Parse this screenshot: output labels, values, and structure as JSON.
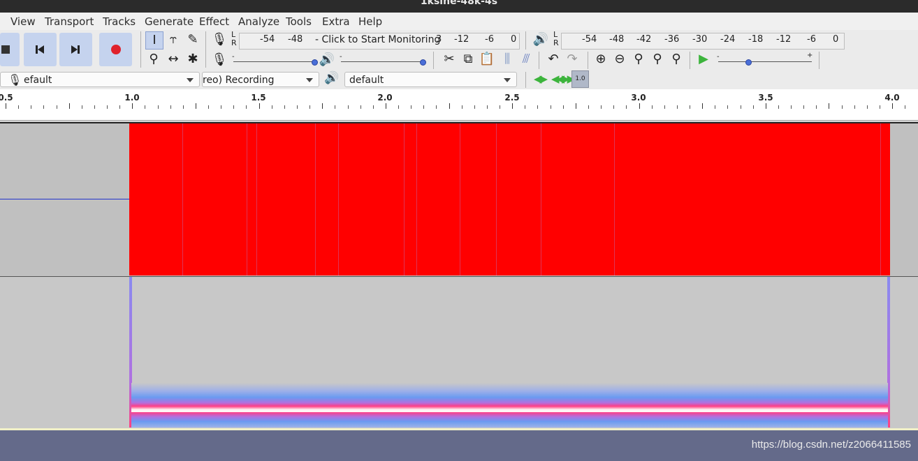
{
  "window": {
    "title": "1ksine-48k-4s"
  },
  "menu": [
    "View",
    "Transport",
    "Tracks",
    "Generate",
    "Effect",
    "Analyze",
    "Tools",
    "Extra",
    "Help"
  ],
  "meters": {
    "record_scale_left": [
      "-54",
      "-48"
    ],
    "monitor_prompt": "- Click to Start Monitoring",
    "record_scale_right": [
      "3",
      "-12",
      "-6",
      "0"
    ],
    "play_scale": [
      "-54",
      "-48",
      "-42",
      "-36",
      "-30",
      "-24",
      "-18",
      "-12",
      "-6",
      "0"
    ],
    "lr_l": "L",
    "lr_r": "R"
  },
  "device_bar": {
    "recording_device": "efault",
    "recording_channels": "reo) Recording Channels",
    "playback_device": "default"
  },
  "ruler": {
    "labels": [
      "0.5",
      "1.0",
      "1.5",
      "2.0",
      "2.5",
      "3.0",
      "3.5",
      "4.0"
    ]
  },
  "timeline": {
    "rate_label": "1.0"
  },
  "icons": {
    "transport": [
      "stop-icon",
      "skip-to-start-icon",
      "skip-to-end-icon",
      "record-icon"
    ],
    "tools": [
      "selection-tool-icon",
      "envelope-tool-icon",
      "draw-tool-icon",
      "zoom-tool-icon",
      "timeshift-tool-icon",
      "multi-tool-icon"
    ],
    "edit": [
      "cut-icon",
      "copy-icon",
      "paste-icon",
      "trim-icon",
      "silence-icon",
      "undo-icon",
      "redo-icon",
      "zoom-in-icon",
      "zoom-out-icon",
      "fit-selection-icon",
      "fit-project-icon",
      "zoom-toggle-icon",
      "play-at-speed-icon"
    ]
  },
  "colors": {
    "waveform_clip": "#ff0000",
    "selection_bg": "#c5d3ee",
    "record_button": "#e0212b",
    "play_green": "#3cb43c",
    "status_bar": "#646a8a"
  },
  "watermark": "https://blog.csdn.net/z2066411585"
}
